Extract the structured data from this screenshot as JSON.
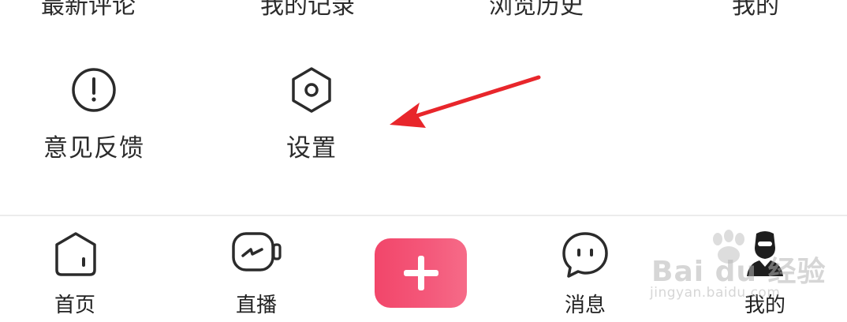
{
  "top_row": {
    "cut_texts": [
      "最新评论",
      "我的记录",
      "浏览历史",
      "我的"
    ]
  },
  "menu": {
    "items": [
      {
        "label": "意见反馈",
        "icon": "feedback-exclamation-icon"
      },
      {
        "label": "设置",
        "icon": "hexagon-settings-icon"
      }
    ]
  },
  "annotation": {
    "arrow_color": "#e8262b",
    "points_to": "设置"
  },
  "tab_bar": {
    "tabs": [
      {
        "label": "首页",
        "icon": "home-icon"
      },
      {
        "label": "直播",
        "icon": "live-camera-icon"
      },
      {
        "label": "",
        "icon": "plus-icon"
      },
      {
        "label": "消息",
        "icon": "chat-bubble-icon"
      },
      {
        "label": "我的",
        "icon": "profile-icon"
      }
    ],
    "create_button_color": "#f2466a"
  },
  "watermark": {
    "brand": "Bai du 经验",
    "url": "jingyan.baidu.com"
  }
}
